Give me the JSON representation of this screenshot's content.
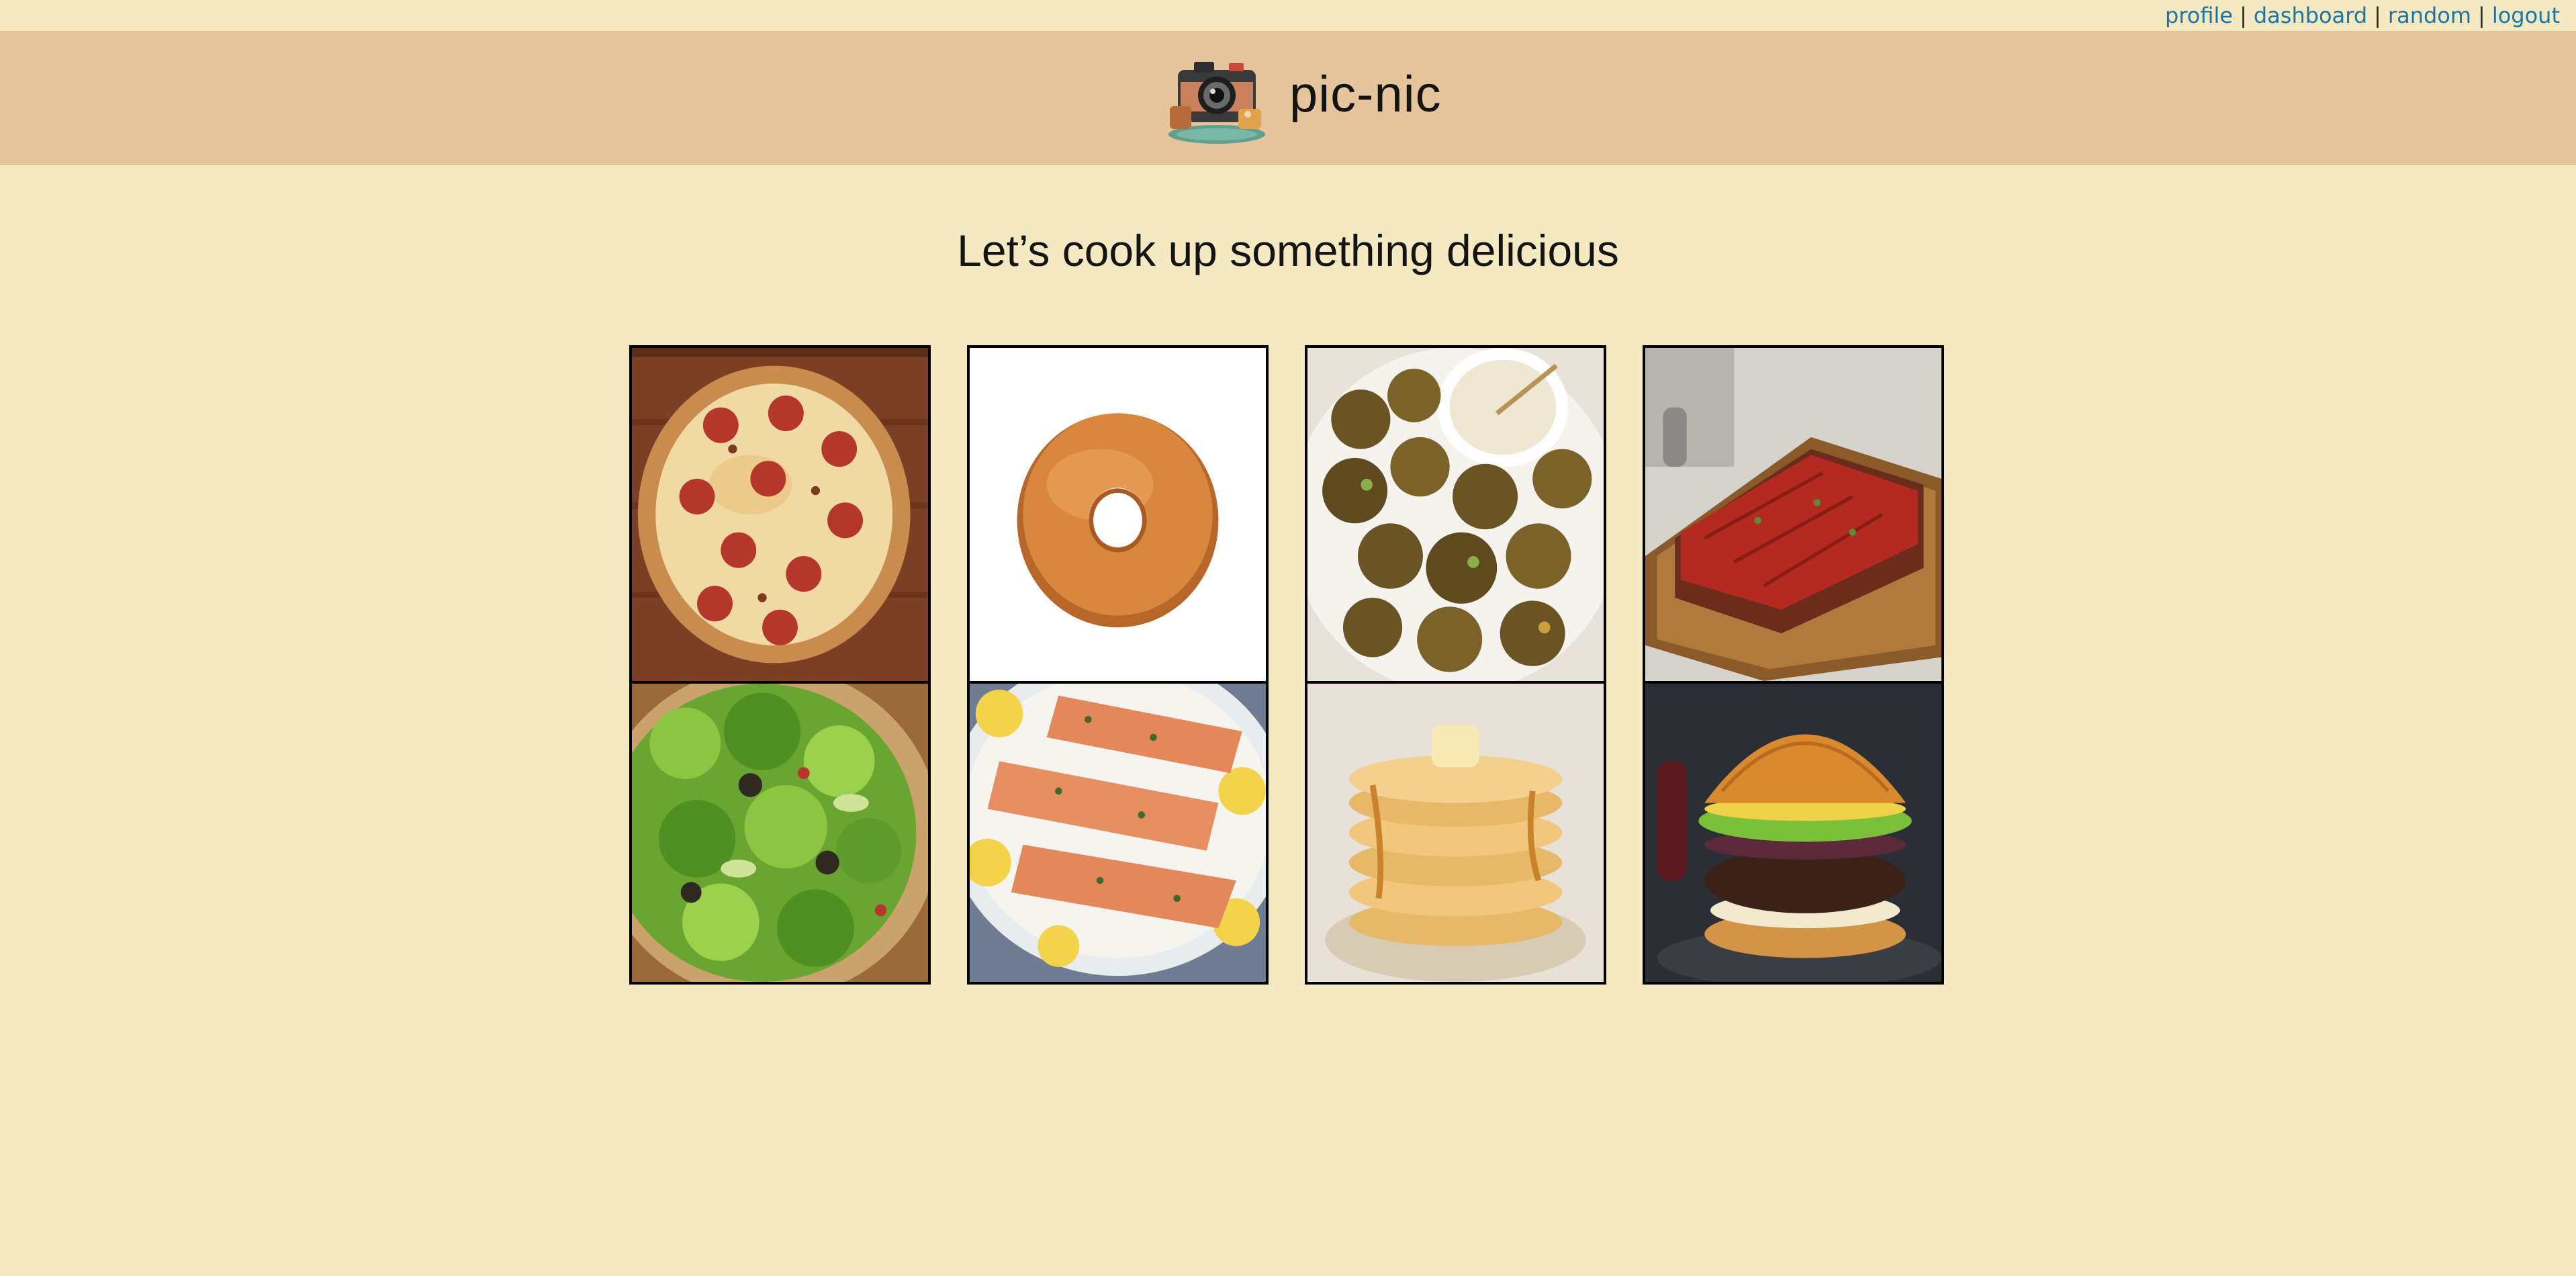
{
  "topnav": {
    "links": [
      {
        "label": "profile"
      },
      {
        "label": "dashboard"
      },
      {
        "label": "random"
      },
      {
        "label": "logout"
      }
    ],
    "separator": "|",
    "link_color": "#1a74a8"
  },
  "header": {
    "logo_icon": "camera-picnic-icon",
    "title": "pic-nic",
    "background": "#e7c59c"
  },
  "main": {
    "headline": "Let’s cook up something delicious",
    "background": "#f5e9c1",
    "recipes": [
      {
        "image": "pizza-photo"
      },
      {
        "image": "donut-photo"
      },
      {
        "image": "falafel-photo"
      },
      {
        "image": "meatloaf-photo"
      },
      {
        "image": "salad-photo"
      },
      {
        "image": "salmon-photo"
      },
      {
        "image": "pancakes-photo"
      },
      {
        "image": "burger-photo"
      }
    ]
  }
}
